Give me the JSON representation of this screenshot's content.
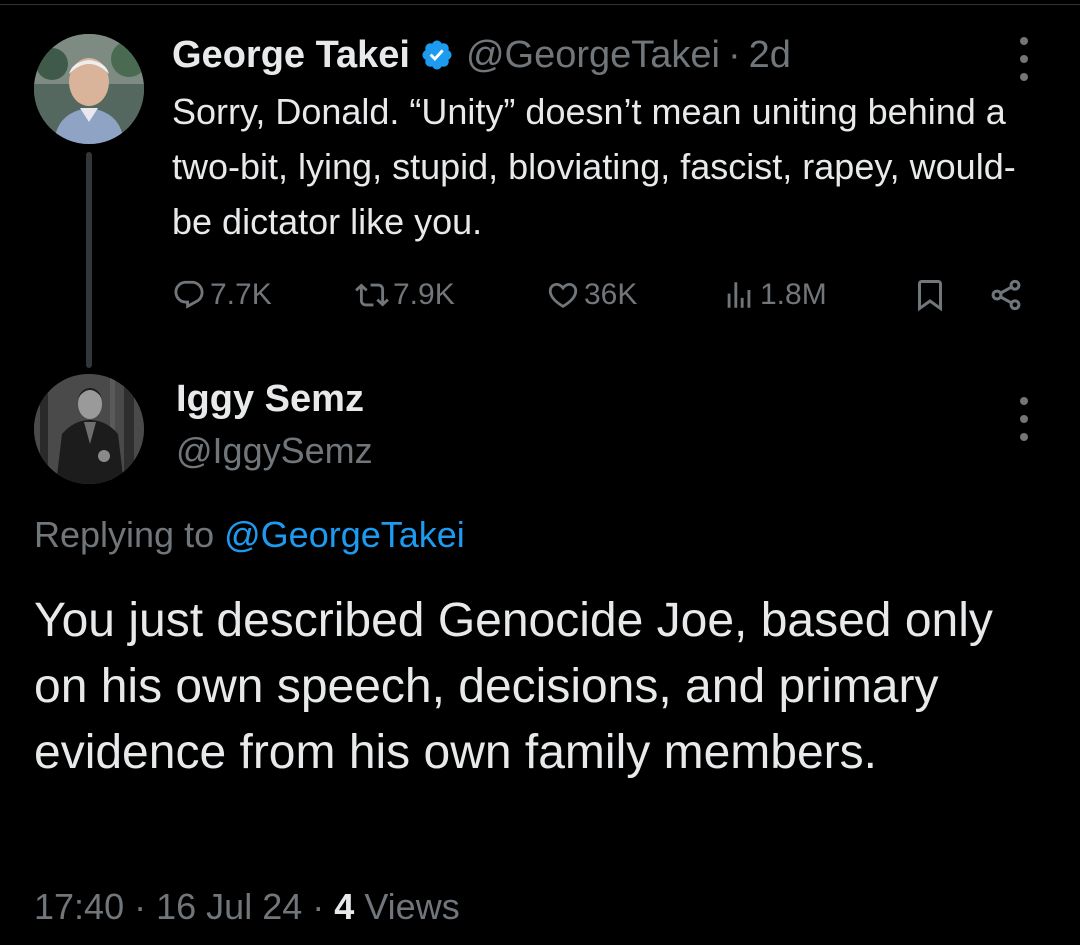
{
  "parent": {
    "display_name": "George Takei",
    "handle": "@GeorgeTakei",
    "separator": "·",
    "age": "2d",
    "text": "Sorry, Donald. “Unity” doesn’t mean uniting behind a two-bit, lying, stupid, bloviating, fascist, rapey, would-be dictator like you.",
    "stats": {
      "replies": "7.7K",
      "reposts": "7.9K",
      "likes": "36K",
      "views": "1.8M"
    },
    "icons": {
      "verified": "verified-badge-icon",
      "reply": "reply-icon",
      "repost": "repost-icon",
      "like": "heart-icon",
      "views": "views-icon",
      "bookmark": "bookmark-icon",
      "share": "share-icon",
      "more": "more-icon"
    }
  },
  "reply": {
    "display_name": "Iggy Semz",
    "handle": "@IggySemz",
    "replying_prefix": "Replying to",
    "replying_mention": "@GeorgeTakei",
    "text": "You just described Genocide Joe, based only on his own speech, decisions, and primary evidence from his own family members.",
    "time": "17:40",
    "separator": "·",
    "date": "16 Jul 24",
    "views_count": "4",
    "views_label": "Views"
  },
  "colors": {
    "background": "#000000",
    "primary_text": "#e7e9ea",
    "secondary_text": "#71767b",
    "accent": "#1d9bf0"
  }
}
